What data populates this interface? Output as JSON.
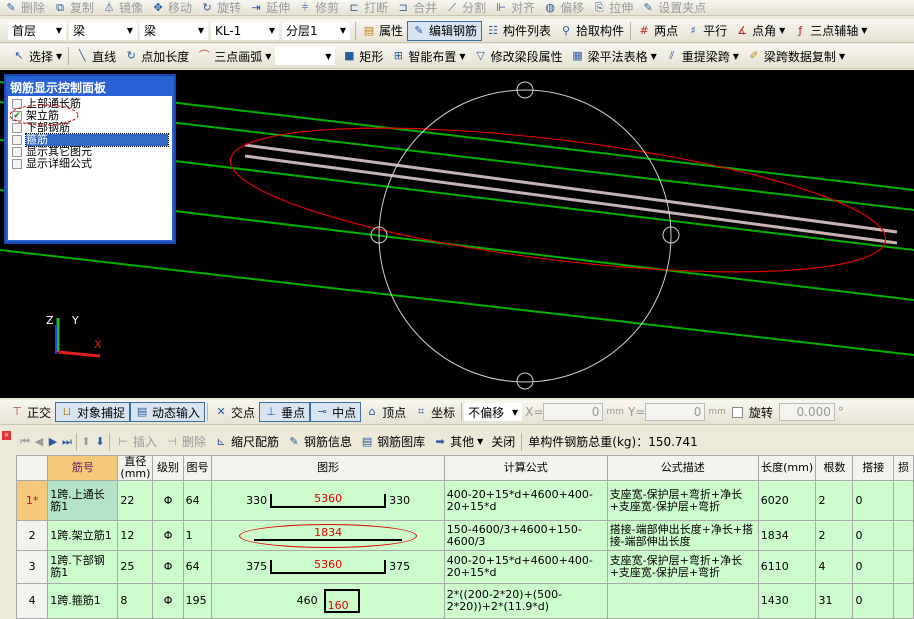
{
  "toolbar1": [
    "删除",
    "复制",
    "镜像",
    "移动",
    "旋转",
    "延伸",
    "修剪",
    "打断",
    "合并",
    "分割",
    "对齐",
    "偏移",
    "拉伸",
    "设置夹点"
  ],
  "toolbar2": {
    "selects": [
      "首层",
      "梁",
      "梁",
      "KL-1",
      "分层1"
    ],
    "buttons": [
      "属性",
      "编辑钢筋",
      "构件列表",
      "拾取构件",
      "两点",
      "平行",
      "点角",
      "三点辅轴"
    ]
  },
  "toolbar3": [
    "选择",
    "直线",
    "点加长度",
    "三点画弧",
    "矩形",
    "智能布置",
    "修改梁段属性",
    "梁平法表格",
    "重提梁跨",
    "梁跨数据复制"
  ],
  "panel": {
    "title": "钢筋显示控制面板",
    "items": [
      {
        "label": "上部通长筋",
        "checked": false
      },
      {
        "label": "架立筋",
        "checked": true
      },
      {
        "label": "下部钢筋",
        "checked": false
      },
      {
        "label": "箍筋",
        "checked": false,
        "selected": true
      },
      {
        "label": "显示其它图元",
        "checked": false
      },
      {
        "label": "显示详细公式",
        "checked": false
      }
    ]
  },
  "axes": {
    "z": "Z",
    "y": "Y",
    "x": "X"
  },
  "snapbar": {
    "buttons": [
      "正交",
      "对象捕捉",
      "动态输入",
      "交点",
      "垂点",
      "中点",
      "顶点",
      "坐标"
    ],
    "offset": "不偏移",
    "x_label": "X=",
    "x_value": "0",
    "y_label": "Y=",
    "y_value": "0",
    "unit": "mm",
    "rotate_label": "旋转",
    "rotate_value": "0.000",
    "deg": "°"
  },
  "rebarbar": {
    "buttons": [
      "插入",
      "删除",
      "缩尺配筋",
      "钢筋信息",
      "钢筋图库",
      "其他",
      "关闭"
    ],
    "total_label": "单构件钢筋总重(kg)：150.741"
  },
  "colors": {
    "beam_line": "#00b000",
    "rebar_line": "#c8b4b4",
    "highlight": "#e00000"
  },
  "table": {
    "headers": [
      "",
      "筋号",
      "直径(mm)",
      "级别",
      "图号",
      "图形",
      "计算公式",
      "公式描述",
      "长度(mm)",
      "根数",
      "搭接",
      "损"
    ],
    "rows": [
      {
        "no": "1*",
        "name": "1跨.上通长筋1",
        "dia": "22",
        "grade": "Φ",
        "fig": "64",
        "left": "330",
        "mid": "5360",
        "right": "330",
        "formula": "400-20+15*d+4600+400-20+15*d",
        "desc": "支座宽-保护层+弯折+净长+支座宽-保护层+弯折",
        "len": "6020",
        "count": "2",
        "lap": "0"
      },
      {
        "no": "2",
        "name": "1跨.架立筋1",
        "dia": "12",
        "grade": "Φ",
        "fig": "1",
        "left": "",
        "mid": "1834",
        "right": "",
        "formula": "150-4600/3+4600+150-4600/3",
        "desc": "搭接-端部伸出长度+净长+搭接-端部伸出长度",
        "len": "1834",
        "count": "2",
        "lap": "0"
      },
      {
        "no": "3",
        "name": "1跨.下部钢筋1",
        "dia": "25",
        "grade": "Φ",
        "fig": "64",
        "left": "375",
        "mid": "5360",
        "right": "375",
        "formula": "400-20+15*d+4600+400-20+15*d",
        "desc": "支座宽-保护层+弯折+净长+支座宽-保护层+弯折",
        "len": "6110",
        "count": "4",
        "lap": "0"
      },
      {
        "no": "4",
        "name": "1跨.箍筋1",
        "dia": "8",
        "grade": "Φ",
        "fig": "195",
        "left": "460",
        "mid": "160",
        "right": "",
        "formula": "2*((200-2*20)+(500-2*20))+2*(11.9*d)",
        "desc": "",
        "len": "1430",
        "count": "31",
        "lap": "0"
      }
    ]
  }
}
